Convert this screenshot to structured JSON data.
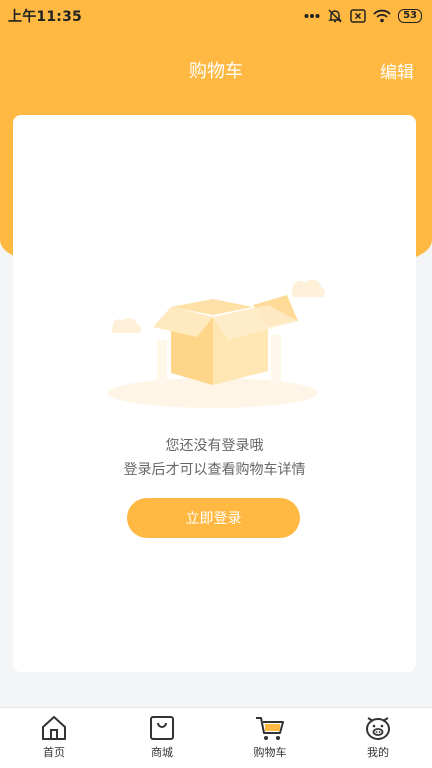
{
  "status_bar": {
    "time": "上午11:35",
    "battery": "53",
    "icons": [
      "dots-icon",
      "mute-bell-icon",
      "sim-x-icon",
      "wifi-icon",
      "battery-icon"
    ]
  },
  "header": {
    "title": "购物车",
    "edit_label": "编辑"
  },
  "empty_state": {
    "line1": "您还没有登录哦",
    "line2": "登录后才可以查看购物车详情",
    "button_label": "立即登录",
    "illustration": "empty-box-illustration"
  },
  "tabbar": {
    "items": [
      {
        "label": "首页",
        "icon": "home-icon"
      },
      {
        "label": "商城",
        "icon": "store-bag-icon"
      },
      {
        "label": "购物车",
        "icon": "cart-icon",
        "active": true
      },
      {
        "label": "我的",
        "icon": "pig-face-icon"
      }
    ]
  },
  "colors": {
    "accent": "#ffb942",
    "background": "#f4f5f7",
    "card": "#ffffff",
    "text_secondary": "#666666"
  }
}
